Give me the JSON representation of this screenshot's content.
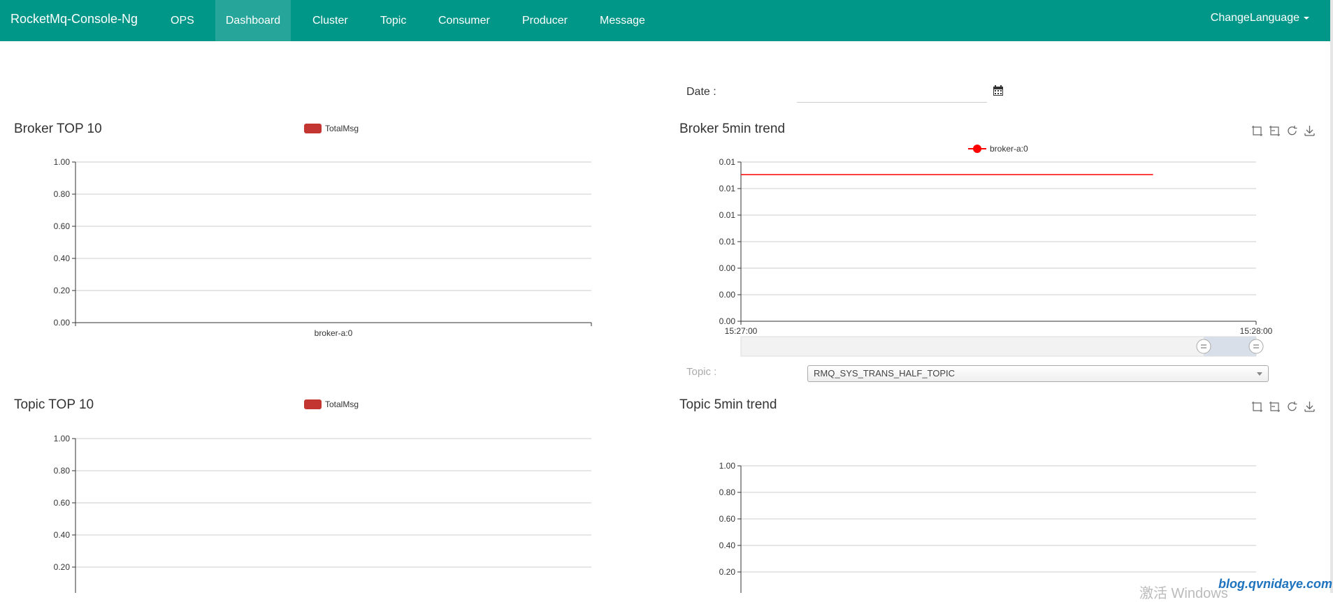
{
  "navbar": {
    "brand": "RocketMq-Console-Ng",
    "items": [
      {
        "label": "OPS"
      },
      {
        "label": "Dashboard",
        "active": true
      },
      {
        "label": "Cluster"
      },
      {
        "label": "Topic"
      },
      {
        "label": "Consumer"
      },
      {
        "label": "Producer"
      },
      {
        "label": "Message"
      }
    ],
    "language": "ChangeLanguage",
    "color": "#009688"
  },
  "date": {
    "label": "Date :",
    "value": ""
  },
  "topic_selector": {
    "label": "Topic :",
    "selected": "RMQ_SYS_TRANS_HALF_TOPIC"
  },
  "watermark": {
    "text": "激活 Windows",
    "site": "blog.qvnidaye.com"
  },
  "chart_data": [
    {
      "type": "bar",
      "title": "Broker TOP 10",
      "legend": [
        "TotalMsg"
      ],
      "categories": [
        "broker-a:0"
      ],
      "series": [
        {
          "name": "TotalMsg",
          "values": [
            0
          ]
        }
      ],
      "yticks": [
        "1.00",
        "0.80",
        "0.60",
        "0.40",
        "0.20",
        "0.00"
      ],
      "ylim": [
        0,
        1
      ],
      "color": "#c23531"
    },
    {
      "type": "line",
      "title": "Broker 5min trend",
      "legend": [
        "broker-a:0"
      ],
      "xticks": [
        "15:27:00",
        "15:28:00"
      ],
      "yticks": [
        "0.01",
        "0.01",
        "0.01",
        "0.01",
        "0.00",
        "0.00",
        "0.00"
      ],
      "series": [
        {
          "name": "broker-a:0",
          "x": [
            "15:27:00",
            "15:27:48"
          ],
          "y": [
            0.01,
            0.01
          ]
        }
      ],
      "color": "#ff0000"
    },
    {
      "type": "bar",
      "title": "Topic TOP 10",
      "legend": [
        "TotalMsg"
      ],
      "categories": [],
      "yticks": [
        "1.00",
        "0.80",
        "0.60",
        "0.40",
        "0.20"
      ],
      "ylim": [
        0,
        1
      ],
      "color": "#c23531"
    },
    {
      "type": "line",
      "title": "Topic 5min trend",
      "legend": [],
      "yticks": [
        "1.00",
        "0.80",
        "0.60",
        "0.40",
        "0.20"
      ],
      "ylim": [
        0,
        1
      ]
    }
  ]
}
